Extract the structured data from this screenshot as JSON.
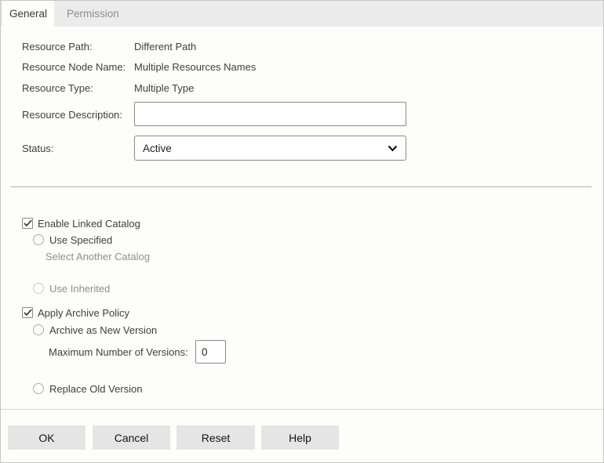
{
  "tabs": [
    {
      "label": "General",
      "active": true
    },
    {
      "label": "Permission",
      "active": false
    }
  ],
  "fields": {
    "resource_path": {
      "label": "Resource Path:",
      "value": "Different Path"
    },
    "resource_node_name": {
      "label": "Resource Node Name:",
      "value": "Multiple Resources Names"
    },
    "resource_type": {
      "label": "Resource Type:",
      "value": "Multiple Type"
    },
    "resource_description": {
      "label": "Resource Description:",
      "value": "",
      "placeholder": ""
    },
    "status": {
      "label": "Status:",
      "value": "Active"
    }
  },
  "linked_catalog": {
    "enable_label": "Enable Linked Catalog",
    "enable_checked": true,
    "use_specified_label": "Use Specified",
    "use_specified_selected": false,
    "select_another_catalog_label": "Select Another Catalog",
    "use_inherited_label": "Use Inherited",
    "use_inherited_selected": false
  },
  "archive_policy": {
    "apply_label": "Apply Archive Policy",
    "apply_checked": true,
    "archive_as_new_version_label": "Archive as New Version",
    "archive_as_new_version_selected": false,
    "max_versions_label": "Maximum Number of Versions:",
    "max_versions_value": "0",
    "replace_old_version_label": "Replace Old Version",
    "replace_old_version_selected": false
  },
  "buttons": {
    "ok": "OK",
    "cancel": "Cancel",
    "reset": "Reset",
    "help": "Help"
  },
  "icons": {
    "chevron": "chevron-down-icon",
    "check": "check-icon"
  },
  "colors": {
    "panel_border": "#c6c6c6",
    "tabstrip_bg": "#ececec",
    "text": "#3e3e3e",
    "muted_text": "#8e8e8e",
    "input_border": "#8a8a8a",
    "button_bg": "#e5e5e5",
    "divider": "#b0b0b0"
  }
}
